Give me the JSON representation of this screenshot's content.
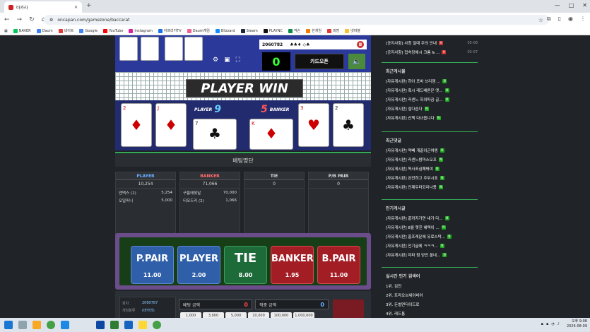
{
  "browser": {
    "tab_title": "바카라",
    "url": "oncapan.com/gamezone/baccarat",
    "bookmarks": [
      "NAVER",
      "Daum",
      "네이트",
      "Google",
      "YouTube",
      "Instagram",
      "아프리카TV",
      "Daum게임",
      "Blizzard",
      "Steam",
      "PLAYNC",
      "넥슨",
      "한게임",
      "피망",
      "넷마블"
    ]
  },
  "game": {
    "round_no": "2060782",
    "counter": "0",
    "card_open_label": "카드오픈",
    "result_banner": "PLAYER WIN",
    "player_label": "PLAYER",
    "player_score": "9",
    "banker_label": "BANKER",
    "banker_score": "5",
    "cards": {
      "player": [
        {
          "rank": "2",
          "suit": "♦",
          "color": "red"
        },
        {
          "rank": "J",
          "suit": "♦",
          "color": "red"
        },
        {
          "rank": "7",
          "suit": "♣",
          "color": "black"
        }
      ],
      "banker": [
        {
          "rank": "K",
          "suit": "♦",
          "color": "red"
        },
        {
          "rank": "3",
          "suit": "♥",
          "color": "red"
        },
        {
          "rank": "2",
          "suit": "♣",
          "color": "black"
        }
      ]
    }
  },
  "bet_status": {
    "title": "베팅명단",
    "columns": [
      {
        "name": "PLAYER",
        "color": "#6ab0ff",
        "total": "10,254",
        "rows": [
          {
            "user": "앤맥스 (2)",
            "amount": "5,254"
          },
          {
            "user": "오일머니",
            "amount": "5,000"
          }
        ]
      },
      {
        "name": "BANKER",
        "color": "#ff6b6b",
        "total": "71,066",
        "rows": [
          {
            "user": "구름에젖달",
            "amount": "70,000"
          },
          {
            "user": "티모드리 (2)",
            "amount": "1,066"
          }
        ]
      },
      {
        "name": "TIE",
        "color": "#dddddd",
        "total": "0",
        "rows": []
      },
      {
        "name": "P/B PAIR",
        "color": "#dddddd",
        "total": "0",
        "rows": []
      }
    ]
  },
  "bet_buttons": [
    {
      "label": "P.PAIR",
      "odds": "11.00",
      "color": "blue"
    },
    {
      "label": "PLAYER",
      "odds": "2.00",
      "color": "blue"
    },
    {
      "label": "TIE",
      "odds": "8.00",
      "color": "green"
    },
    {
      "label": "BANKER",
      "odds": "1.95",
      "color": "red"
    },
    {
      "label": "B.PAIR",
      "odds": "11.00",
      "color": "red"
    }
  ],
  "bet_form": {
    "round_label": "회차",
    "round_value": "2060787",
    "game_label": "게임분류",
    "game_value": "(바카라)",
    "bet_amount_label": "베팅 금액",
    "bet_amount_value": "0",
    "win_amount_label": "적중 금액",
    "win_amount_value": "0",
    "chips": [
      "1,000",
      "3,000",
      "5,000",
      "10,000",
      "100,000",
      "1,000,000"
    ]
  },
  "sidebar": {
    "notices": [
      {
        "text": "[공지사항] 사칭 절대 주의 안내",
        "date": "05-08"
      },
      {
        "text": "[공지사항] 접속장애시 크롬 & ...",
        "date": "02-07"
      }
    ],
    "recent_posts_title": "최근게시물",
    "recent_posts": [
      "[자유게시판] 하아 포바 쓰리잼 ...",
      "[자유게시판] 혹시 레드배론은 엣...",
      "[자유게시판] 러센느 하의따끔 곱...",
      "[자유게시판] 설다습다",
      "[자유게시판] 산책 다녀옵니다"
    ],
    "recent_comments_title": "최근댓글",
    "recent_comments": [
      "[자유게시판] 먹빼 개끝이군여엥",
      "[자유게시판] 러센느밤마스오프",
      "[자유게시판] 독사조심해봐여",
      "[자유게시판] 완전하고 주무시죠",
      "[자유게시판] 인제두터되리나용"
    ],
    "popular_title": "인기게시글",
    "popular_posts": [
      "[자유게시판] 끝까지가면 내가 다...",
      "[자유게시판] 8월 멧친 혜택이 ...",
      "[자유게시판] 홈프레문에 유료스탁...",
      "[자유게시판] 인기글에 ㅋㅋㅋ...",
      "[자유게시판] 미파 첨 얻안 꿀네..."
    ],
    "search_title": "실시간 인기 검색어",
    "search_terms": [
      "1위. 김전",
      "2위. 트라오브세이비어",
      "3위. 돈벌면다이드로",
      "4위. 레드통"
    ]
  },
  "taskbar": {
    "time": "오후 9:08",
    "date": "2026-08-09"
  }
}
